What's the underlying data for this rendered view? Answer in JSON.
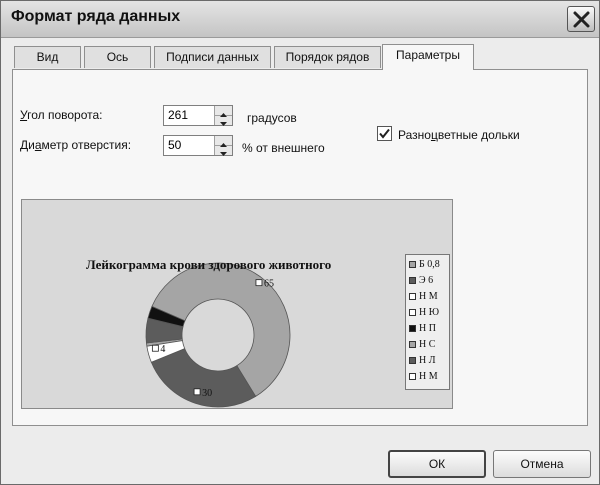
{
  "window": {
    "title": "Формат ряда данных"
  },
  "tabs": [
    {
      "label": "Вид"
    },
    {
      "label": "Ось"
    },
    {
      "label": "Подписи данных"
    },
    {
      "label": "Порядок рядов"
    },
    {
      "label": "Параметры",
      "active": true
    }
  ],
  "params": {
    "rotation": {
      "label_pre": "У",
      "label_rest": "гол поворота:",
      "value": "261",
      "unit": "градусов"
    },
    "hole": {
      "label_pre": "Ди",
      "label_u": "а",
      "label_rest": "метр отверстия:",
      "value": "50",
      "unit": "% от внешнего"
    },
    "vary_colors": {
      "label_pre": "Разно",
      "label_u": "ц",
      "label_rest": "ветные дольки",
      "checked": true
    }
  },
  "chart_data": {
    "type": "doughnut",
    "title": "Лейкограмма крови здорового животного",
    "categories": [
      "Б 0,8",
      "Э 6",
      "Н М",
      "Н Ю",
      "Н П",
      "Н С",
      "Н Л",
      "Н М"
    ],
    "values": [
      0.8,
      6,
      0,
      0,
      3,
      65,
      30,
      4
    ],
    "colors": [
      "#a5a5a5",
      "#5c5c5c",
      "#ffffff",
      "#ffffff",
      "#111111",
      "#a5a5a5",
      "#5c5c5c",
      "#ffffff"
    ],
    "rotation": 261,
    "hole": 50,
    "data_labels": [
      {
        "text": "65",
        "category": "Н С"
      },
      {
        "text": "30",
        "category": "Н Л"
      },
      {
        "text": "4",
        "category": "Н М"
      }
    ]
  },
  "buttons": {
    "ok": "ОК",
    "cancel": "Отмена"
  },
  "colors": {
    "chart_bg": "#d9d9d9",
    "legend_bg": "#efefef"
  }
}
